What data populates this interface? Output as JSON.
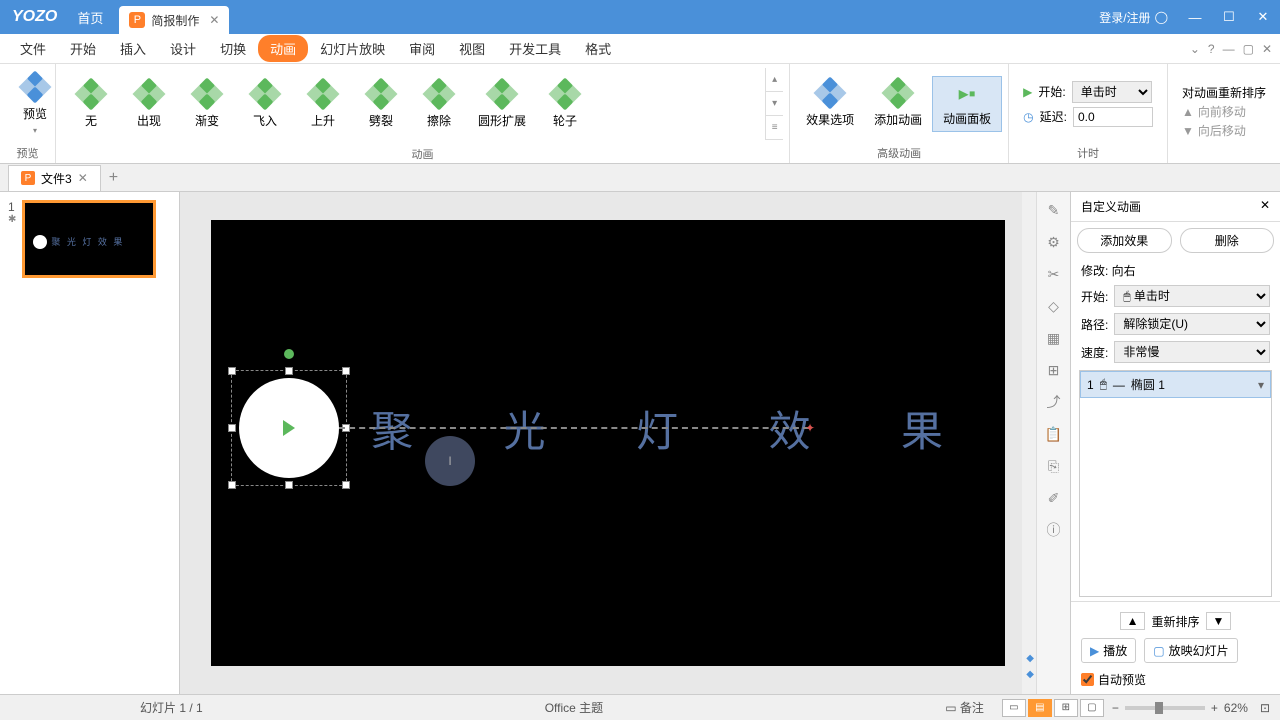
{
  "titlebar": {
    "logo": "YOZO",
    "home": "首页",
    "docTab": "简报制作",
    "login": "登录/注册"
  },
  "menu": {
    "items": [
      "文件",
      "开始",
      "插入",
      "设计",
      "切换",
      "动画",
      "幻灯片放映",
      "审阅",
      "视图",
      "开发工具",
      "格式"
    ],
    "activeIndex": 5
  },
  "ribbon": {
    "preview": "预览",
    "previewGroup": "预览",
    "anims": [
      "无",
      "出现",
      "渐变",
      "飞入",
      "上升",
      "劈裂",
      "擦除",
      "圆形扩展",
      "轮子"
    ],
    "animGroup": "动画",
    "effectOptions": "效果选项",
    "addAnim": "添加动画",
    "animPane": "动画面板",
    "advGroup": "高级动画",
    "startLabel": "开始:",
    "startValue": "单击时",
    "delayLabel": "延迟:",
    "delayValue": "0.0",
    "timingGroup": "计时",
    "reorderTitle": "对动画重新排序",
    "moveFwd": "向前移动",
    "moveBack": "向后移动"
  },
  "docTabs": {
    "name": "文件3"
  },
  "slidePanel": {
    "num": "1",
    "thumbText": "聚 光 灯 效 果"
  },
  "canvas": {
    "text": "聚 光 灯 效 果"
  },
  "animPanel": {
    "title": "自定义动画",
    "addEffect": "添加效果",
    "delete": "删除",
    "modify": "修改: 向右",
    "startLabel": "开始:",
    "startValue": "单击时",
    "pathLabel": "路径:",
    "pathValue": "解除锁定(U)",
    "speedLabel": "速度:",
    "speedValue": "非常慢",
    "itemNum": "1",
    "itemName": "椭圆 1",
    "reorder": "重新排序",
    "play": "播放",
    "slideshow": "放映幻灯片",
    "autoPreview": "自动预览"
  },
  "status": {
    "slide": "幻灯片 1 / 1",
    "theme": "Office 主题",
    "notes": "备注",
    "zoom": "62%"
  }
}
